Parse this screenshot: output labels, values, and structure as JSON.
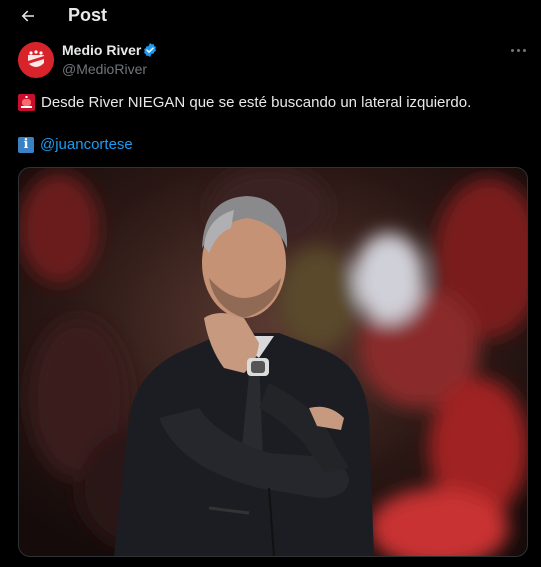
{
  "header": {
    "title": "Post",
    "back_icon": "arrow-left-icon"
  },
  "author": {
    "name": "Medio River",
    "handle": "@MedioRiver",
    "verified": true,
    "avatar_icon": "river-plate-crest-icon"
  },
  "tweet": {
    "line1_emoji": "rotating-light-icon",
    "line1_text": "Desde River NIEGAN que se esté buscando un lateral izquierdo.",
    "line2_emoji": "information-icon",
    "line2_mention": "@juancortese"
  },
  "media": {
    "description_icon": "photo-coach-icon"
  },
  "colors": {
    "accent": "#1d9bf0",
    "verified": "#1d9bf0",
    "background": "#000000",
    "muted": "#71767b"
  }
}
